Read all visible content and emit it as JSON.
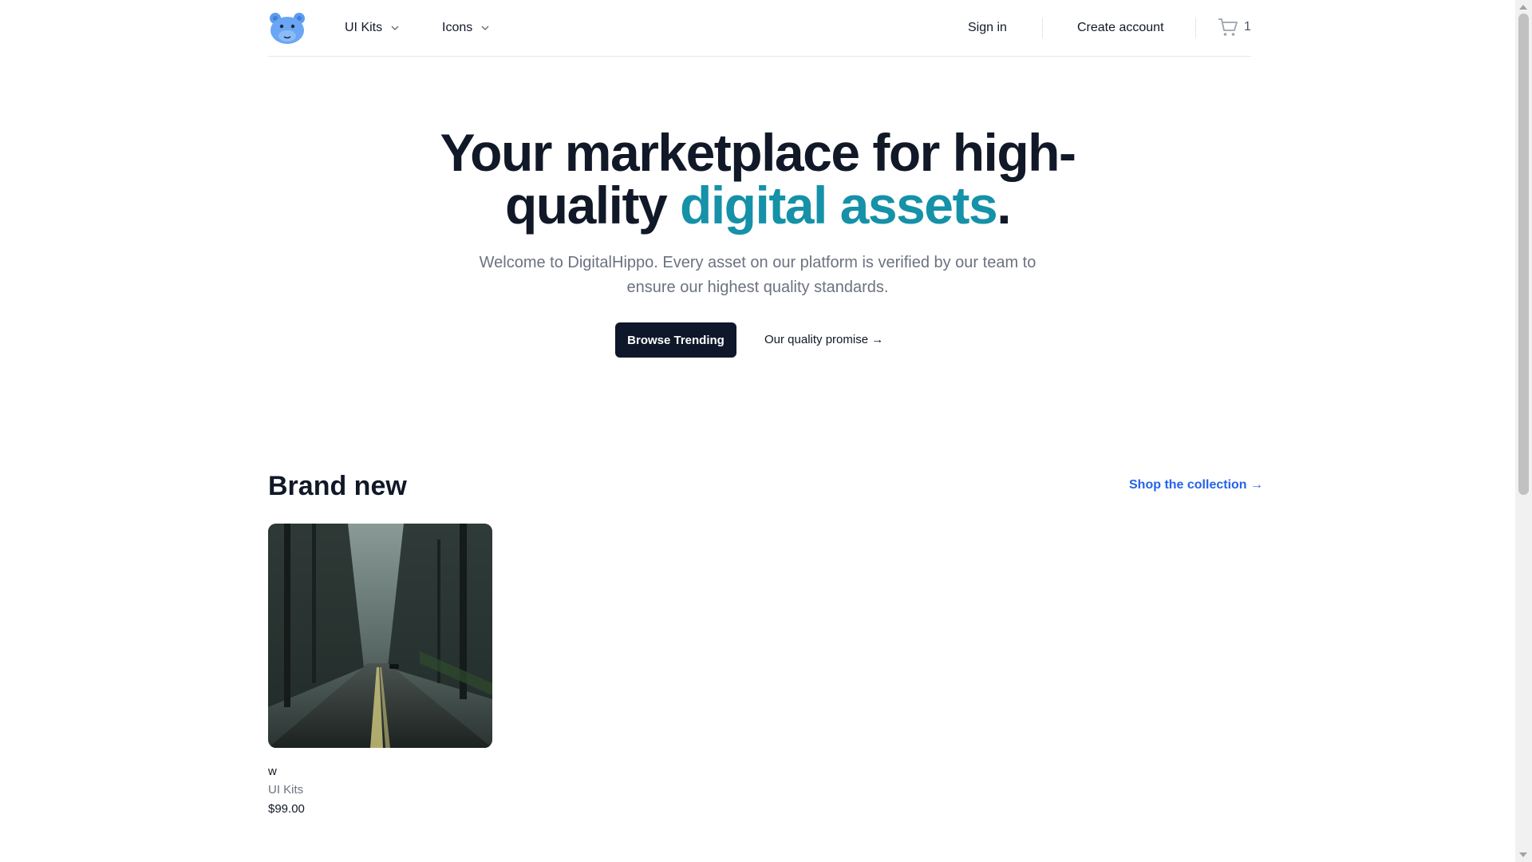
{
  "header": {
    "logo_icon": "hippo-logo-icon",
    "nav": [
      {
        "label": "UI Kits",
        "icon": "chevron-down-icon"
      },
      {
        "label": "Icons",
        "icon": "chevron-down-icon"
      }
    ],
    "sign_in": "Sign in",
    "create_account": "Create account",
    "cart": {
      "icon": "shopping-cart-icon",
      "count": "1"
    }
  },
  "hero": {
    "title_part1": "Your marketplace for high-quality ",
    "title_accent": "digital assets",
    "title_end": ".",
    "subtitle": "Welcome to DigitalHippo. Every asset on our platform is verified by our team to ensure our highest quality standards.",
    "primary_button": "Browse Trending",
    "secondary_link": "Our quality promise →"
  },
  "brand_new": {
    "title": "Brand new",
    "shop_link": "Shop the collection →",
    "products": [
      {
        "name": "w",
        "category": "UI Kits",
        "price": "$99.00",
        "image": "foggy-forest-road-photo"
      }
    ]
  },
  "colors": {
    "accent": "#1591a8",
    "primary_button": "#0f172a",
    "link_blue": "#2563eb",
    "logo_blue": "#5b9cf0"
  }
}
